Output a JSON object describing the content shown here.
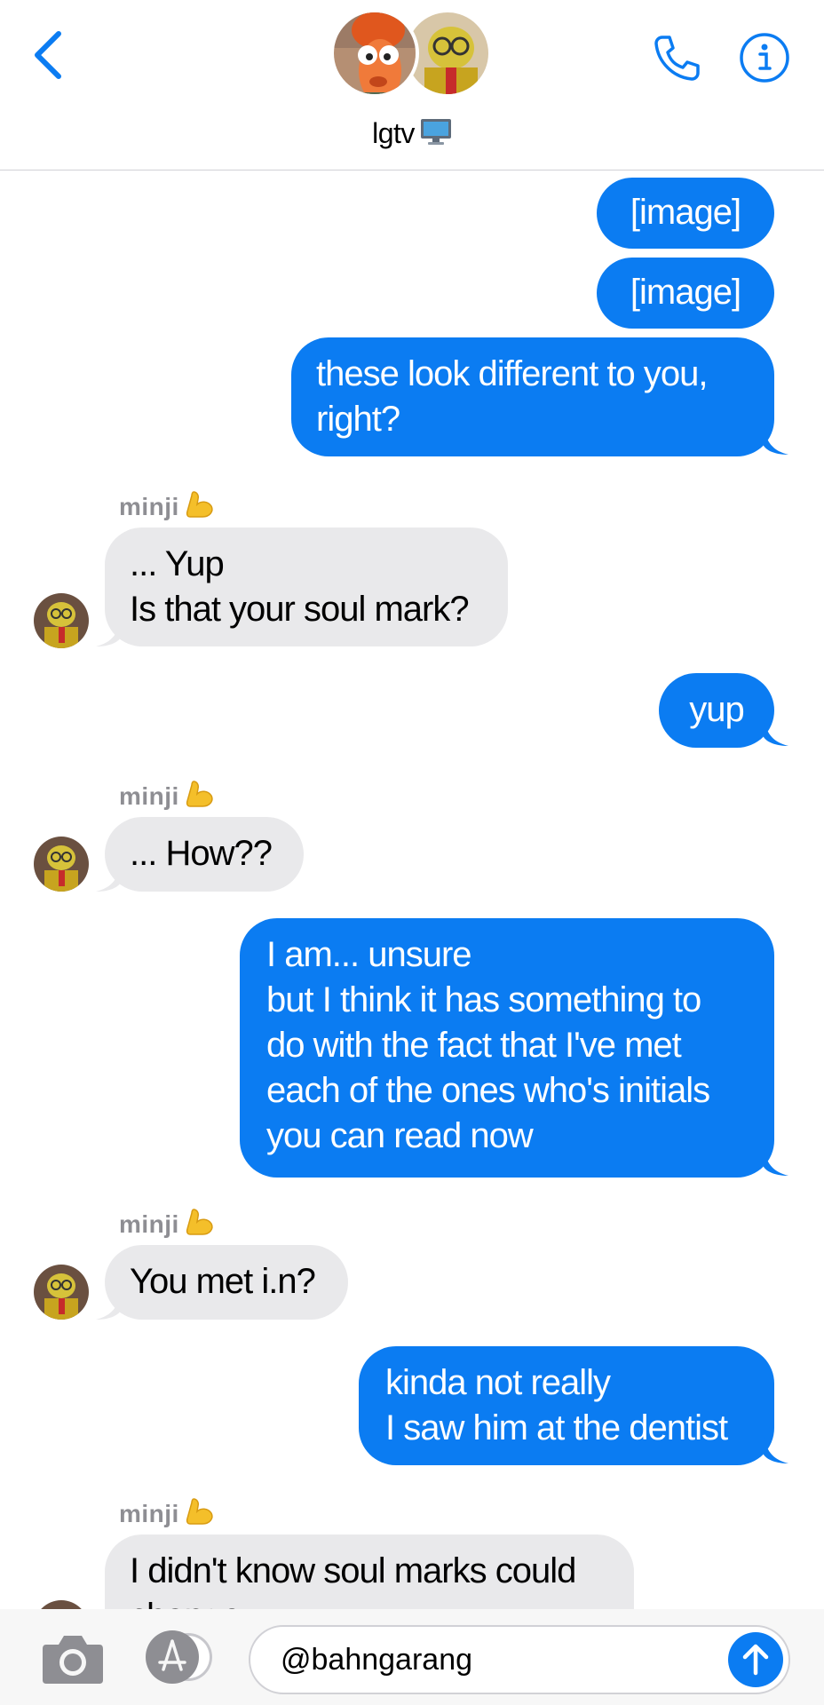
{
  "header": {
    "group_name": "lgtv",
    "group_emoji_icon": "television-icon",
    "back_icon": "chevron-left-icon",
    "phone_icon": "phone-icon",
    "info_icon": "info-icon"
  },
  "colors": {
    "accent": "#0b7cf2",
    "incoming_bubble": "#e9e9eb",
    "sender_label": "#8e8e93"
  },
  "messages": [
    {
      "direction": "out",
      "text": "[image]"
    },
    {
      "direction": "out",
      "text": "[image]"
    },
    {
      "direction": "out",
      "text": "these look different to you,\nright?"
    },
    {
      "direction": "in",
      "sender": "minji",
      "sender_emoji_icon": "flexed-bicep-icon",
      "text": "... Yup\nIs that your soul mark?"
    },
    {
      "direction": "out",
      "text": "yup"
    },
    {
      "direction": "in",
      "sender": "minji",
      "sender_emoji_icon": "flexed-bicep-icon",
      "text": "... How??"
    },
    {
      "direction": "out",
      "text": "I am... unsure\nbut I think it has something to\ndo with the fact that I've met\neach of the ones who's initials\nyou can read now"
    },
    {
      "direction": "in",
      "sender": "minji",
      "sender_emoji_icon": "flexed-bicep-icon",
      "text": "You met i.n?"
    },
    {
      "direction": "out",
      "text": "kinda not really\nI saw him at the dentist"
    },
    {
      "direction": "in",
      "sender": "minji",
      "sender_emoji_icon": "flexed-bicep-icon",
      "text": "I didn't know soul marks could\nchange"
    }
  ],
  "composer": {
    "camera_icon": "camera-icon",
    "apps_icon": "app-store-icon",
    "input_value": "@bahngarang",
    "send_icon": "arrow-up-icon"
  }
}
